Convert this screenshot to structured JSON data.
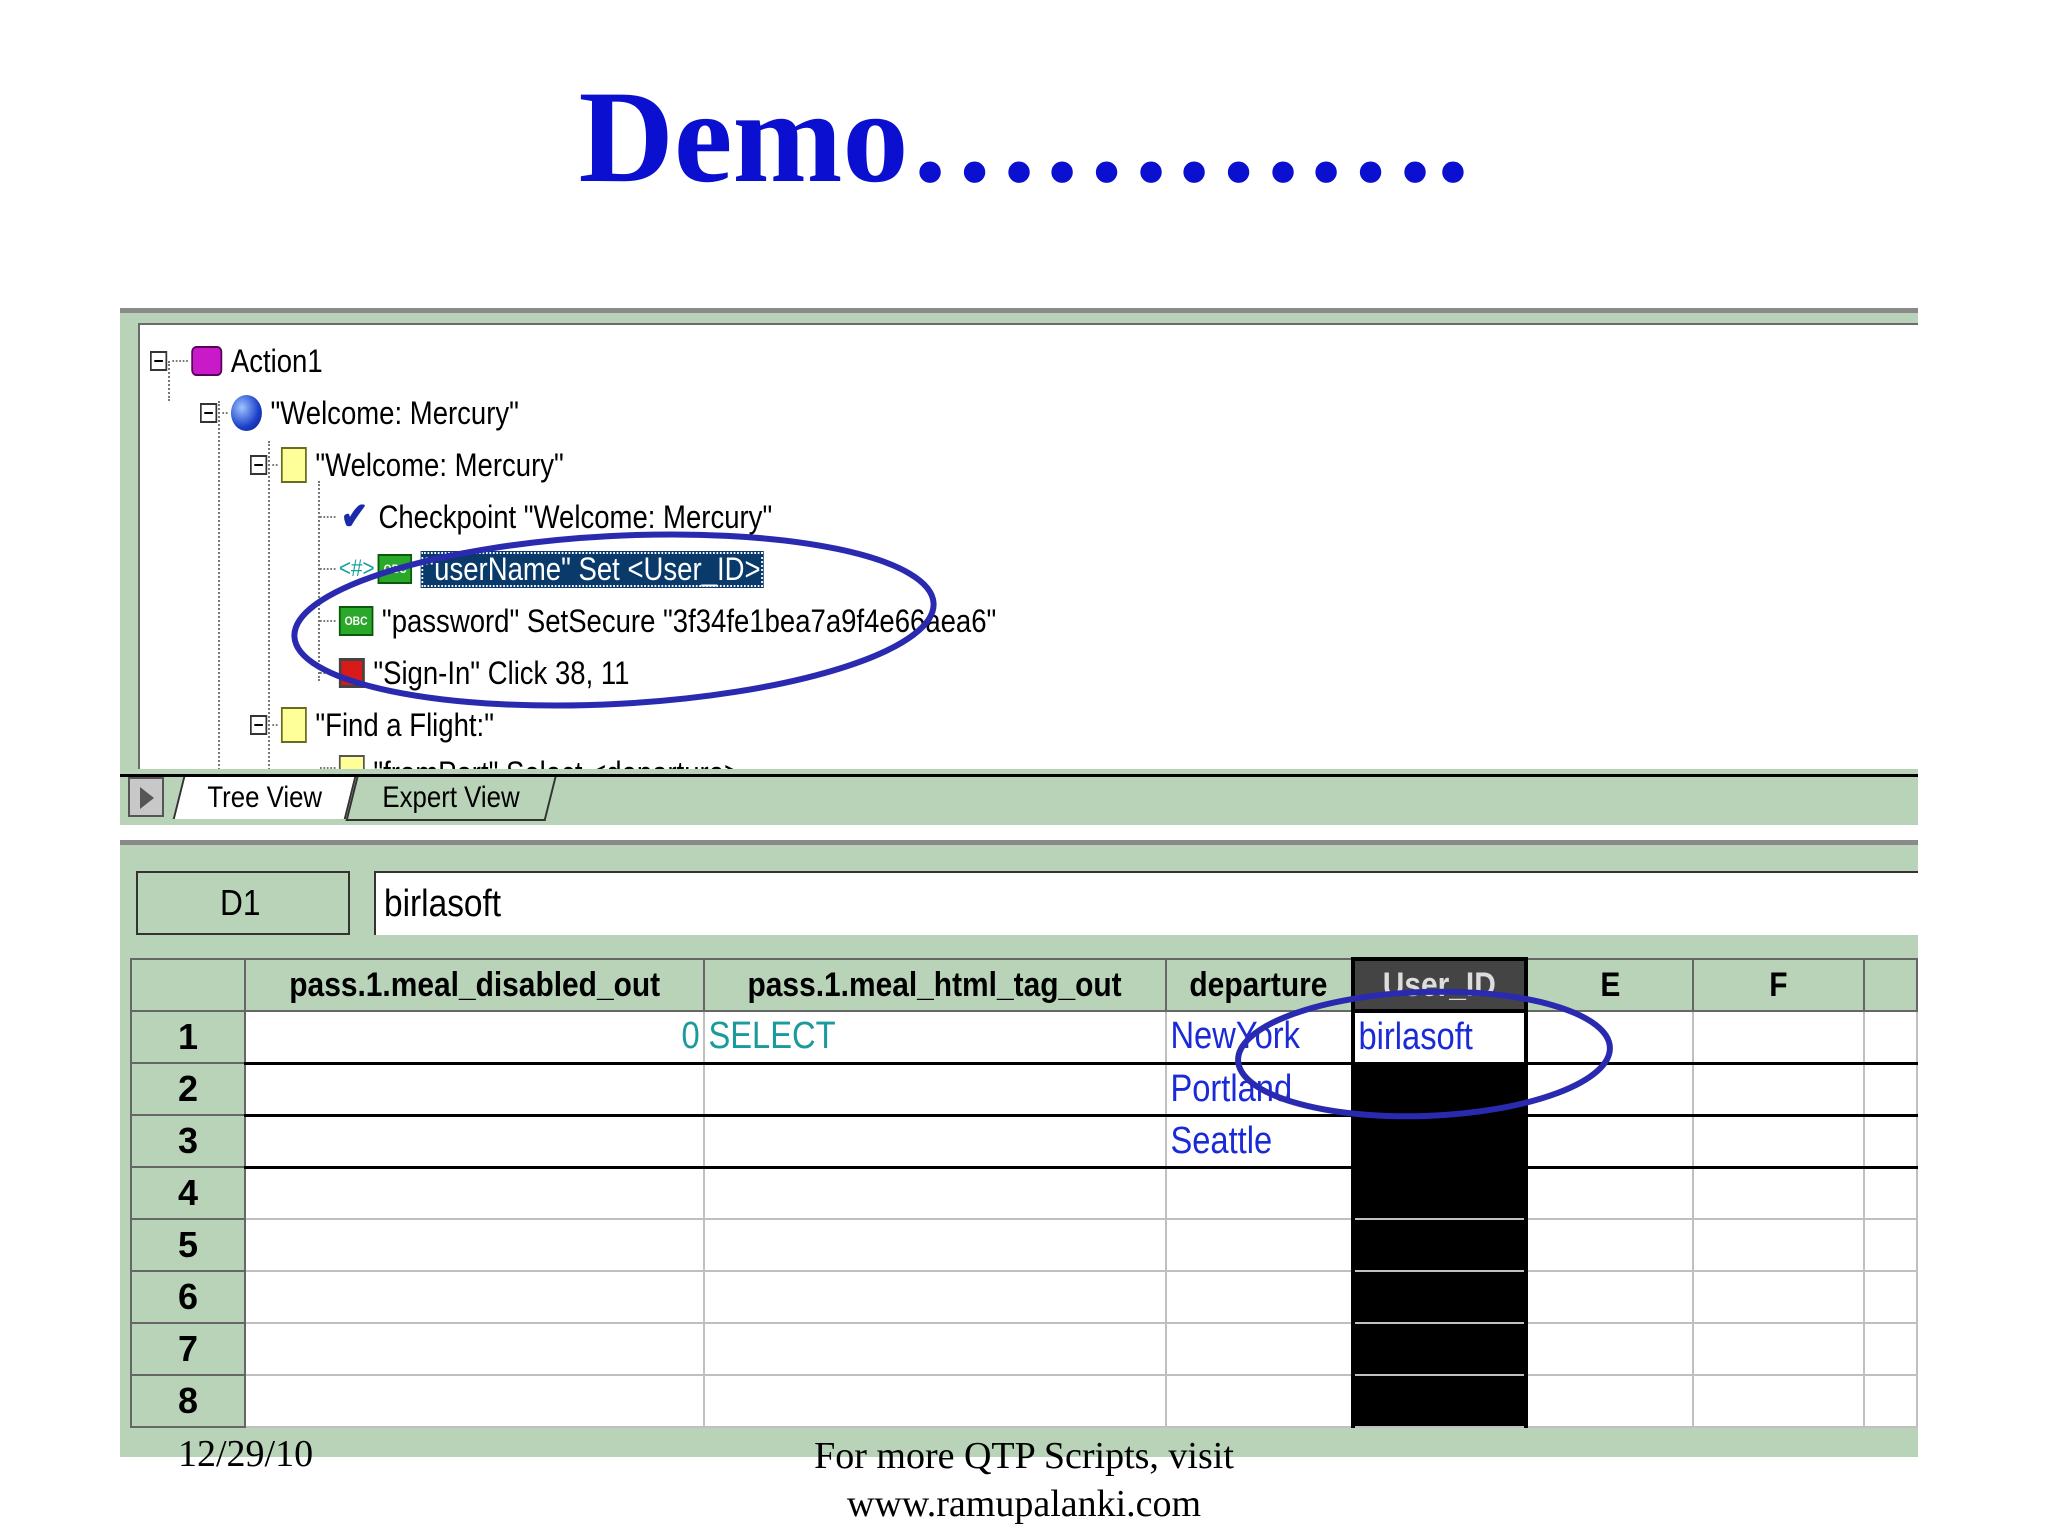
{
  "slide": {
    "title": "Demo………….",
    "footer_date": "12/29/10",
    "footer_line1": "For more QTP Scripts, visit",
    "footer_line2": "www.ramupalanki.com"
  },
  "tree": {
    "items": [
      {
        "label": "Action1",
        "icon": "action-icon"
      },
      {
        "label": "\"Welcome: Mercury\"",
        "icon": "browser-globe-icon"
      },
      {
        "label": "\"Welcome: Mercury\"",
        "icon": "page-icon"
      },
      {
        "label": "Checkpoint \"Welcome: Mercury\"",
        "icon": "checkpoint-icon"
      },
      {
        "label": "\"userName\" Set <User_ID>",
        "icon": "edit-field-icon",
        "selected": true
      },
      {
        "label": "\"password\" SetSecure \"3f34fe1bea7a9f4e66aea6\"",
        "icon": "edit-field-icon"
      },
      {
        "label": "\"Sign-In\" Click 38, 11",
        "icon": "image-button-icon"
      },
      {
        "label": "\"Find a Flight:\"",
        "icon": "page-icon"
      },
      {
        "label": "\"fromPort\" Select <departure>",
        "icon": "list-icon"
      }
    ],
    "tabs": [
      "Tree View",
      "Expert View"
    ]
  },
  "datatable": {
    "cell_ref": "D1",
    "formula_value": "birlasoft",
    "columns": [
      "pass.1.meal_disabled_out",
      "pass.1.meal_html_tag_out",
      "departure",
      "User_ID",
      "E",
      "F"
    ],
    "row_numbers": [
      "1",
      "2",
      "3",
      "4",
      "5",
      "6",
      "7",
      "8"
    ],
    "rows": [
      [
        "0",
        "SELECT",
        "NewYork",
        "birlasoft",
        "",
        ""
      ],
      [
        "",
        "",
        "Portland",
        "",
        "",
        ""
      ],
      [
        "",
        "",
        "Seattle",
        "",
        "",
        ""
      ],
      [
        "",
        "",
        "",
        "",
        "",
        ""
      ],
      [
        "",
        "",
        "",
        "",
        "",
        ""
      ],
      [
        "",
        "",
        "",
        "",
        "",
        ""
      ],
      [
        "",
        "",
        "",
        "",
        "",
        ""
      ],
      [
        "",
        "",
        "",
        "",
        "",
        ""
      ]
    ]
  },
  "colors": {
    "title": "#0a0fd0",
    "panel": "#b8d3b8",
    "annotation": "#2a2ab0",
    "param_text": "#1a2ad8",
    "output_text": "#1a9a9a"
  }
}
